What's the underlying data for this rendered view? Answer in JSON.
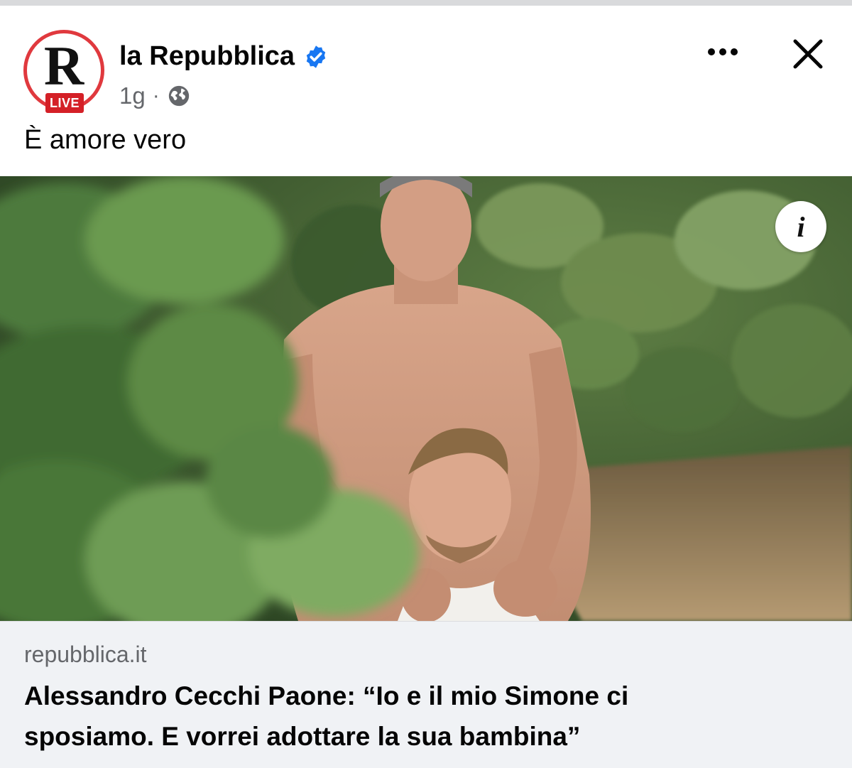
{
  "post": {
    "page_name": "la Repubblica",
    "verified": true,
    "time": "1g",
    "separator": "·",
    "audience_icon": "globe-icon",
    "text": "È amore vero",
    "avatar": {
      "letter": "R",
      "badge": "LIVE",
      "ring_color": "#e0393e"
    },
    "menu_icon": "more-horizontal-icon",
    "close_icon": "close-icon"
  },
  "photo": {
    "info_icon": "i"
  },
  "link": {
    "domain": "repubblica.it",
    "headline": "Alessandro Cecchi Paone: “Io e il mio Simone ci sposiamo. E vorrei adottare la sua bambina”"
  },
  "colors": {
    "verified_blue": "#1877f2",
    "secondary_text": "#65676b",
    "card_bg": "#f0f2f5",
    "live_red": "#d42027"
  }
}
